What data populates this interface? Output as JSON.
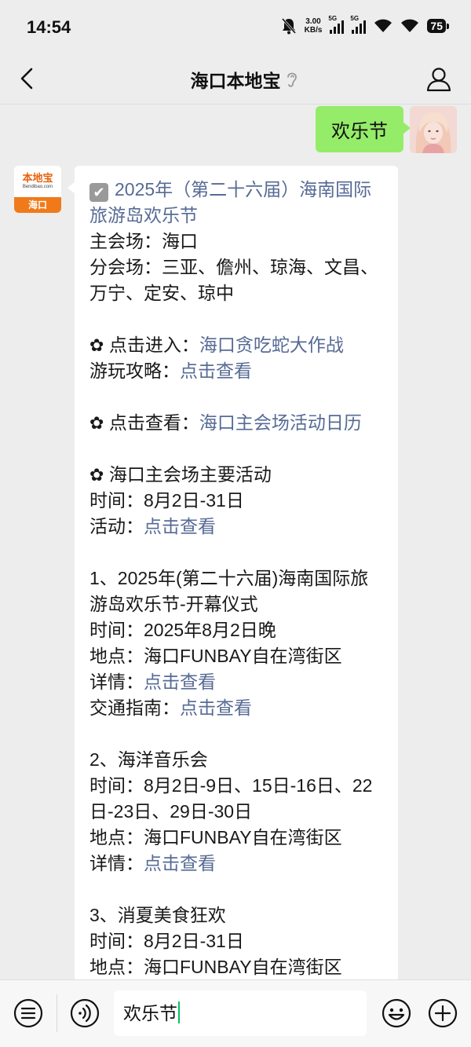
{
  "status": {
    "time": "14:54",
    "net_speed_value": "3.00",
    "net_speed_unit": "KB/s",
    "sim1": "5G",
    "sim2": "5G",
    "battery": "75"
  },
  "header": {
    "title": "海口本地宝"
  },
  "my_message": {
    "text": "欢乐节"
  },
  "bot_avatar": {
    "logo_text": "本地宝",
    "logo_en": "Bendibao.com",
    "city": "海口"
  },
  "bot_message": {
    "headline": "2025年（第二十六届）海南国际旅游岛欢乐节",
    "main_venue": "主会场：海口",
    "sub_venue": "分会场：三亚、儋州、琼海、文昌、万宁、定安、琼中",
    "game_prefix": "点击进入：",
    "game_link": "海口贪吃蛇大作战",
    "guide_prefix": "游玩攻略：",
    "guide_link": "点击查看",
    "calendar_prefix": "点击查看：",
    "calendar_link": "海口主会场活动日历",
    "main_activities_title": "海口主会场主要活动",
    "main_time": "时间：8月2日-31日",
    "main_activity_prefix": "活动：",
    "main_activity_link": "点击查看",
    "item1_title": "1、2025年(第二十六届)海南国际旅游岛欢乐节-开幕仪式",
    "item1_time": "时间：2025年8月2日晚",
    "item1_place": "地点：海口FUNBAY自在湾街区",
    "item1_detail_prefix": "详情：",
    "item1_detail_link": "点击查看",
    "item1_traffic_prefix": "交通指南：",
    "item1_traffic_link": "点击查看",
    "item2_title": "2、海洋音乐会",
    "item2_time": "时间：8月2日-9日、15日-16日、22日-23日、29日-30日",
    "item2_place": "地点：海口FUNBAY自在湾街区",
    "item2_detail_prefix": "详情：",
    "item2_detail_link": "点击查看",
    "item3_title": "3、消夏美食狂欢",
    "item3_time": "时间：8月2日-31日",
    "item3_place": "地点：海口FUNBAY自在湾街区"
  },
  "input": {
    "value": "欢乐节"
  },
  "colors": {
    "link": "#576b95",
    "my_bubble": "#95ec69",
    "cursor": "#07c160"
  }
}
